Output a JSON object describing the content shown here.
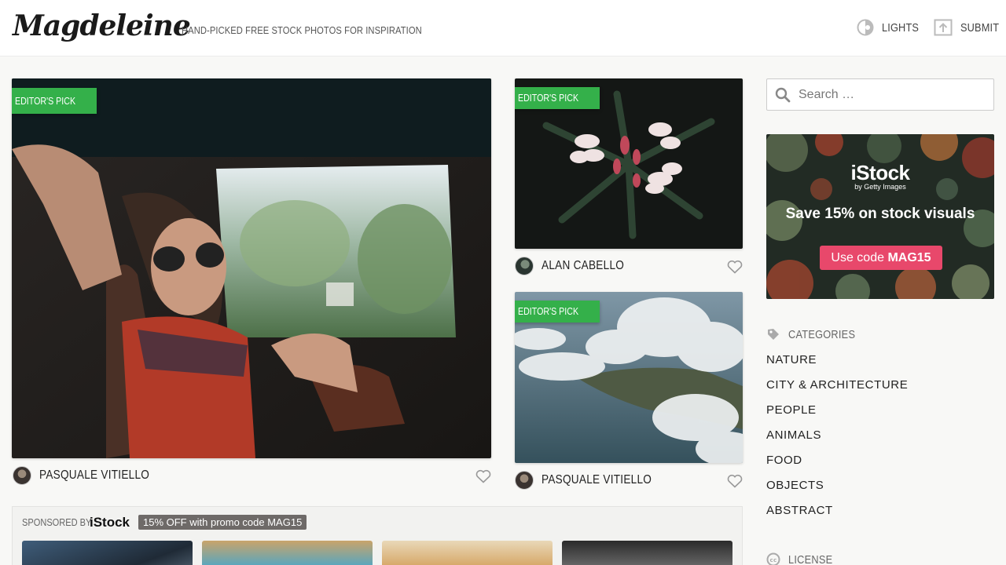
{
  "header": {
    "logo": "Magdeleine",
    "tagline": "HAND-PICKED FREE STOCK PHOTOS FOR INSPIRATION",
    "lights_label": "LIGHTS",
    "submit_label": "SUBMIT"
  },
  "photos": [
    {
      "badge": "EDITOR'S PICK",
      "author": "PASQUALE VITIELLO"
    },
    {
      "badge": "EDITOR'S PICK",
      "author": "ALAN CABELLO"
    },
    {
      "badge": "EDITOR'S PICK",
      "author": "PASQUALE VITIELLO"
    }
  ],
  "sponsored": {
    "label": "SPONSORED BY",
    "brand": "iStock",
    "promo": "15% OFF with promo code MAG15"
  },
  "sidebar": {
    "search_placeholder": "Search …",
    "ad": {
      "brand": "iStock",
      "by": "by Getty Images",
      "headline": "Save 15% on stock visuals",
      "cta_prefix": "Use code ",
      "cta_code": "MAG15"
    },
    "categories_title": "CATEGORIES",
    "categories": [
      "NATURE",
      "CITY & ARCHITECTURE",
      "PEOPLE",
      "ANIMALS",
      "FOOD",
      "OBJECTS",
      "ABSTRACT"
    ],
    "license_title": "LICENSE"
  },
  "colors": {
    "accent_green": "#34b04a",
    "cta_pink": "#e8486b"
  }
}
